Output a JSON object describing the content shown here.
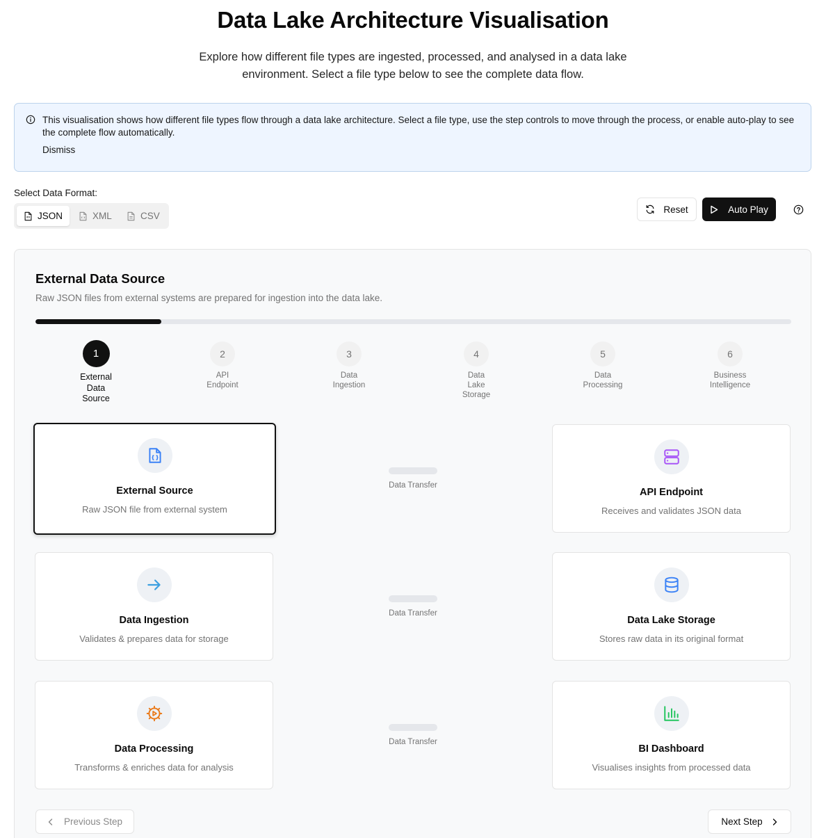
{
  "header": {
    "title": "Data Lake Architecture Visualisation",
    "subtitle": "Explore how different file types are ingested, processed, and analysed in a data lake environment. Select a file type below to see the complete data flow."
  },
  "info": {
    "text": "This visualisation shows how different file types flow through a data lake architecture. Select a file type, use the step controls to move through the process, or enable auto-play to see the complete flow automatically.",
    "dismiss_label": "Dismiss"
  },
  "format": {
    "label": "Select Data Format:",
    "tabs": [
      {
        "label": "JSON",
        "icon": "file-json-icon",
        "selected": true
      },
      {
        "label": "XML",
        "icon": "file-code-icon",
        "selected": false
      },
      {
        "label": "CSV",
        "icon": "file-text-icon",
        "selected": false
      }
    ]
  },
  "controls": {
    "reset_label": "Reset",
    "autoplay_label": "Auto Play",
    "help_icon": "help-circle-icon"
  },
  "current_step": {
    "title": "External Data Source",
    "description": "Raw JSON files from external systems are prepared for ingestion into the data lake.",
    "progress": 0.1667
  },
  "stepper": [
    {
      "number": "1",
      "label": "External Data Source",
      "active": true
    },
    {
      "number": "2",
      "label": "API Endpoint",
      "active": false
    },
    {
      "number": "3",
      "label": "Data Ingestion",
      "active": false
    },
    {
      "number": "4",
      "label": "Data Lake Storage",
      "active": false
    },
    {
      "number": "5",
      "label": "Data Processing",
      "active": false
    },
    {
      "number": "6",
      "label": "Business Intelligence",
      "active": false
    }
  ],
  "cards": [
    {
      "title": "External Source",
      "description": "Raw JSON file from external system",
      "icon": "file-json-icon",
      "icon_color": "#3b82f6",
      "selected": true
    },
    {
      "title": "API Endpoint",
      "description": "Receives and validates JSON data",
      "icon": "server-icon",
      "icon_color": "#a855f7",
      "selected": false
    },
    {
      "title": "Data Ingestion",
      "description": "Validates & prepares data for storage",
      "icon": "arrow-right-icon",
      "icon_color": "#3b9fe0",
      "selected": false
    },
    {
      "title": "Data Lake Storage",
      "description": "Stores raw data in its original format",
      "icon": "database-icon",
      "icon_color": "#3b82f6",
      "selected": false
    },
    {
      "title": "Data Processing",
      "description": "Transforms & enriches data for analysis",
      "icon": "cog-play-icon",
      "icon_color": "#ea7a1a",
      "selected": false
    },
    {
      "title": "BI Dashboard",
      "description": "Visualises insights from processed data",
      "icon": "bar-chart-icon",
      "icon_color": "#22c55e",
      "selected": false
    }
  ],
  "transfers": [
    {
      "label": "Data Transfer"
    },
    {
      "label": "Data Transfer"
    },
    {
      "label": "Data Transfer"
    }
  ],
  "navigation": {
    "prev_label": "Previous Step",
    "next_label": "Next Step"
  }
}
